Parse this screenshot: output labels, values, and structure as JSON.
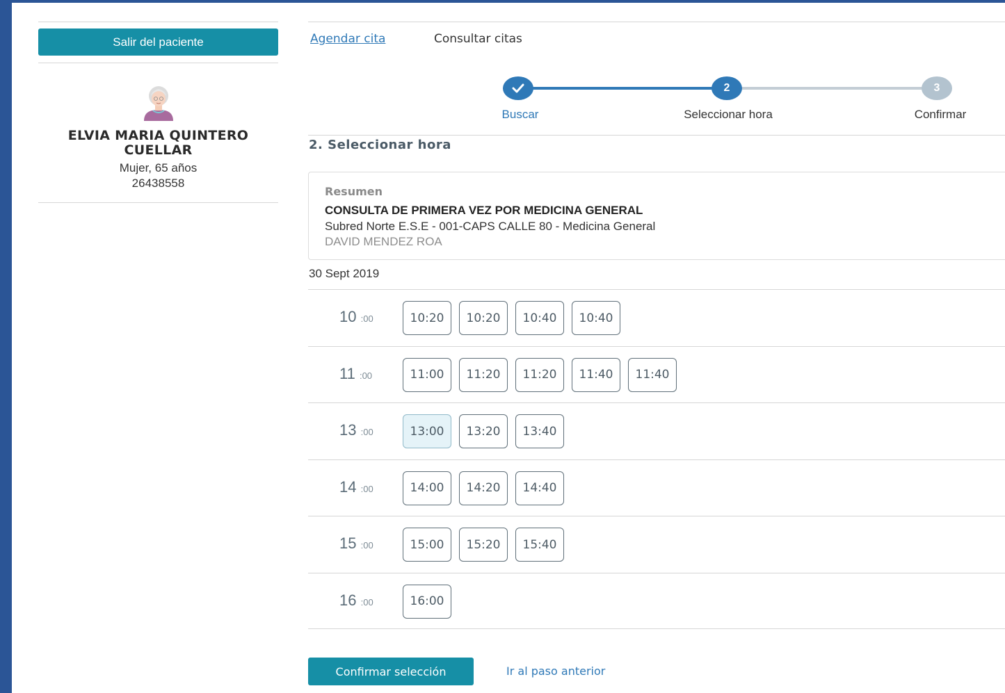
{
  "sidebar": {
    "exit_label": "Salir del paciente",
    "patient_name": "ELVIA MARIA QUINTERO CUELLAR",
    "patient_gender_age": "Mujer, 65 años",
    "patient_id": "26438558"
  },
  "tabs": {
    "schedule": "Agendar cita",
    "consult": "Consultar citas"
  },
  "steps": [
    {
      "number": "",
      "label": "Buscar",
      "state": "done"
    },
    {
      "number": "2",
      "label": "Seleccionar hora",
      "state": "active"
    },
    {
      "number": "3",
      "label": "Confirmar",
      "state": "pending"
    }
  ],
  "section_title": "2. Seleccionar hora",
  "summary": {
    "label": "Resumen",
    "title": "CONSULTA DE PRIMERA VEZ POR MEDICINA GENERAL",
    "place": "Subred Norte E.S.E - 001-CAPS CALLE 80 - Medicina General",
    "doctor": "DAVID MENDEZ ROA"
  },
  "date": "30 Sept 2019",
  "schedule": [
    {
      "hour": "10",
      "suffix": ":00",
      "times": [
        "10:20",
        "10:20",
        "10:40",
        "10:40"
      ]
    },
    {
      "hour": "11",
      "suffix": ":00",
      "times": [
        "11:00",
        "11:20",
        "11:20",
        "11:40",
        "11:40"
      ]
    },
    {
      "hour": "13",
      "suffix": ":00",
      "times": [
        "13:00",
        "13:20",
        "13:40"
      ]
    },
    {
      "hour": "14",
      "suffix": ":00",
      "times": [
        "14:00",
        "14:20",
        "14:40"
      ]
    },
    {
      "hour": "15",
      "suffix": ":00",
      "times": [
        "15:00",
        "15:20",
        "15:40"
      ]
    },
    {
      "hour": "16",
      "suffix": ":00",
      "times": [
        "16:00"
      ]
    }
  ],
  "selected_time": "13:00",
  "actions": {
    "confirm": "Confirmar selección",
    "back": "Ir al paso anterior"
  },
  "colors": {
    "accent": "#168fa6",
    "step_active": "#2f79b7",
    "step_pending": "#b3c3cf",
    "link": "#2f79b7",
    "background": "#2b5596"
  }
}
